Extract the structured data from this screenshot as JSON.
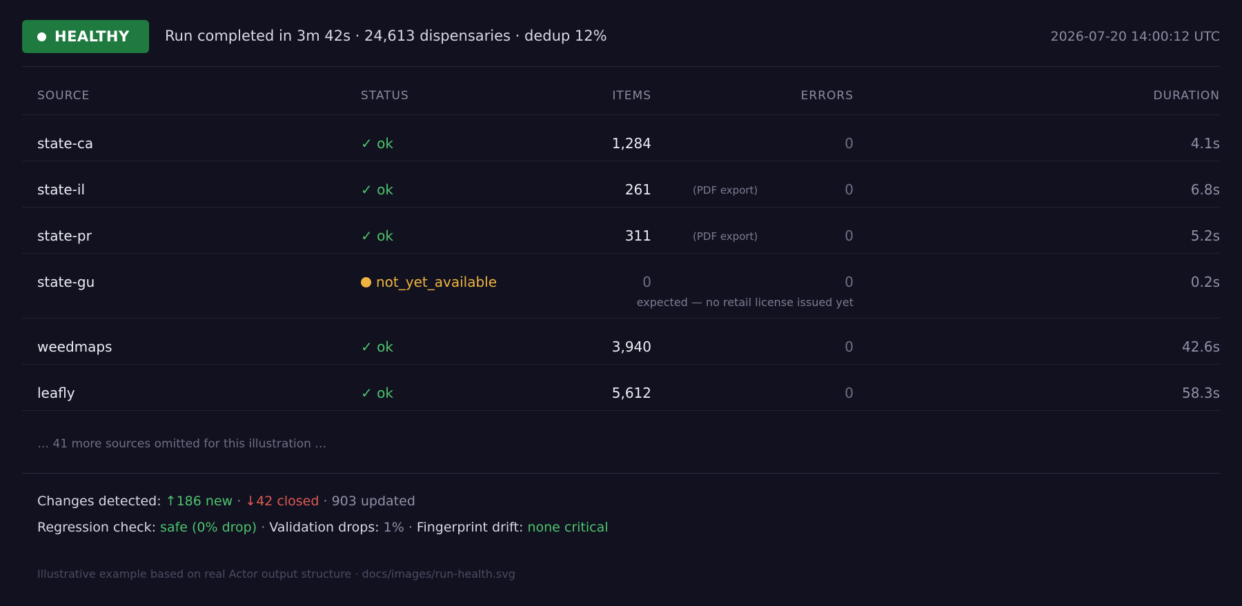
{
  "header": {
    "badge_label": "HEALTHY",
    "summary": "Run completed in 3m 42s · 24,613 dispensaries · dedup 12%",
    "timestamp": "2026-07-20 14:00:12 UTC"
  },
  "table": {
    "columns": {
      "source": "SOURCE",
      "status": "STATUS",
      "items": "ITEMS",
      "errors": "ERRORS",
      "duration": "DURATION"
    },
    "rows": [
      {
        "source": "state-ca",
        "status": "✓ ok",
        "items": "1,284",
        "note": "",
        "errors": "0",
        "duration": "4.1s"
      },
      {
        "source": "state-il",
        "status": "✓ ok",
        "items": "261",
        "note": "(PDF export)",
        "errors": "0",
        "duration": "6.8s"
      },
      {
        "source": "state-pr",
        "status": "✓ ok",
        "items": "311",
        "note": "(PDF export)",
        "errors": "0",
        "duration": "5.2s"
      },
      {
        "source": "state-gu",
        "status": "not_yet_available",
        "items": "0",
        "note": "",
        "errors": "0",
        "duration": "0.2s",
        "sub_note": "expected — no retail license issued yet"
      },
      {
        "source": "weedmaps",
        "status": "✓ ok",
        "items": "3,940",
        "note": "",
        "errors": "0",
        "duration": "42.6s"
      },
      {
        "source": "leafly",
        "status": "✓ ok",
        "items": "5,612",
        "note": "",
        "errors": "0",
        "duration": "58.3s"
      }
    ],
    "omitted_text": "… 41 more sources omitted for this illustration …"
  },
  "footer": {
    "changes_label": "Changes detected:",
    "new_text": "↑186 new",
    "closed_text": "↓42 closed",
    "updated_text": "903 updated",
    "regression_label": "Regression check:",
    "regression_value": "safe (0% drop)",
    "validation_label": "Validation drops:",
    "validation_value": "1%",
    "drift_label": "Fingerprint drift:",
    "drift_value": "none critical",
    "separator": " · ",
    "caption": "Illustrative example based on real Actor output structure · docs/images/run-health.svg"
  },
  "colors": {
    "background": "#11111f",
    "healthy": "#1f7a3f",
    "ok": "#4ec46e",
    "warning": "#efb43f",
    "closed": "#e05a52"
  },
  "icons": {
    "badge_dot": "status-dot-icon",
    "ok": "checkmark-icon",
    "warning": "warning-dot-icon"
  }
}
